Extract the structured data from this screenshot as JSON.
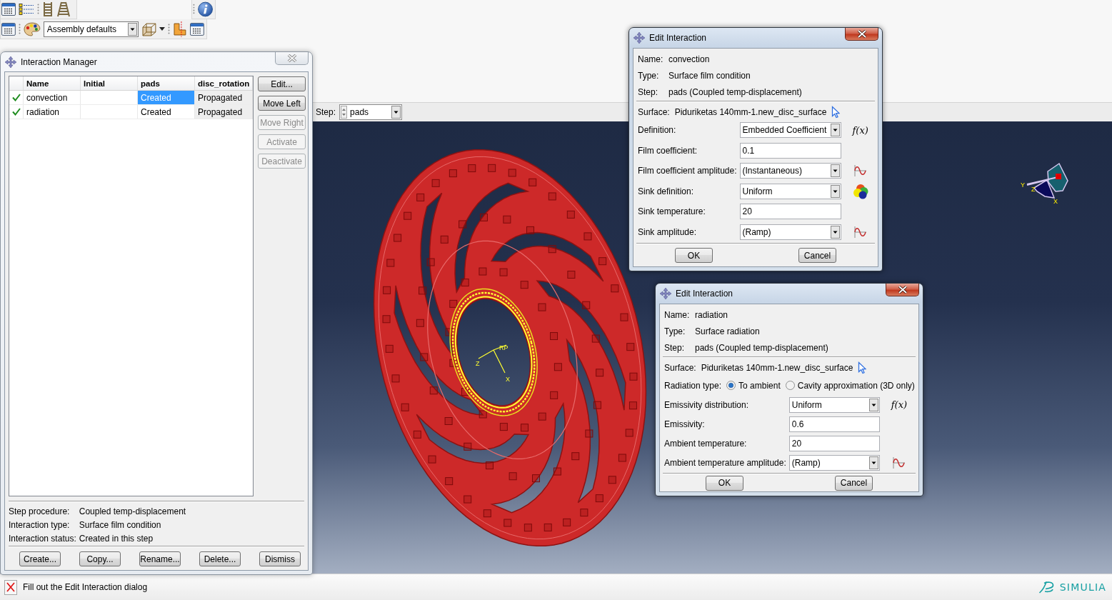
{
  "toolbar": {
    "color_scheme_select": {
      "value": "Assembly defaults"
    }
  },
  "context_bar": {
    "step_label": "Step:",
    "step_select": {
      "value": "pads"
    }
  },
  "viewport": {
    "reference_point": {
      "label": "RP",
      "axis_labels": [
        "Z",
        "X"
      ]
    },
    "view_triad": {
      "axis_labels": [
        "Y",
        "Z",
        "X"
      ]
    }
  },
  "interaction_manager": {
    "title": "Interaction Manager",
    "focused": false,
    "table": {
      "columns": [
        "Name",
        "Initial",
        "pads",
        "disc_rotation"
      ],
      "rows": [
        {
          "active": true,
          "cells": [
            {
              "text": "convection",
              "selected": false,
              "shaded": false
            },
            {
              "selected": false,
              "shaded": false
            },
            {
              "text": "Created",
              "selected": true,
              "shaded": false
            },
            {
              "text": "Propagated",
              "selected": false,
              "shaded": true
            }
          ]
        },
        {
          "active": true,
          "cells": [
            {
              "text": "radiation",
              "selected": false,
              "shaded": false
            },
            {
              "selected": false,
              "shaded": false
            },
            {
              "text": "Created",
              "selected": false,
              "shaded": false
            },
            {
              "text": "Propagated",
              "selected": false,
              "shaded": true
            }
          ]
        }
      ]
    },
    "side_buttons": [
      {
        "label": "Edit...",
        "disabled": false
      },
      {
        "label": "Move Left",
        "disabled": false
      },
      {
        "label": "Move Right",
        "disabled": true
      },
      {
        "label": "Activate",
        "disabled": true
      },
      {
        "label": "Deactivate",
        "disabled": true
      }
    ],
    "details": [
      {
        "label": "Step procedure:",
        "value": "Coupled temp-displacement"
      },
      {
        "label": "Interaction type:",
        "value": "Surface film condition"
      },
      {
        "label": "Interaction status:",
        "value": "Created in this step"
      }
    ],
    "buttons": [
      "Create...",
      "Copy...",
      "Rename...",
      "Delete...",
      "Dismiss"
    ]
  },
  "edit_dialogs": [
    {
      "title": "Edit Interaction",
      "focused": true,
      "info": [
        {
          "label": "Name:",
          "value": "convection"
        },
        {
          "label": "Type:",
          "value": "Surface film condition"
        },
        {
          "label": "Step:",
          "value": "pads (Coupled temp-displacement)"
        }
      ],
      "surface": {
        "label": "Surface:",
        "value": "Piduriketas 140mm-1.new_disc_surface"
      },
      "fields": [
        {
          "kind": "select",
          "label": "Definition:",
          "value": "Embedded Coefficient",
          "accessory": {
            "kind": "function",
            "text": "f(x)"
          }
        },
        {
          "kind": "text",
          "label": "Film coefficient:",
          "value": "0.1"
        },
        {
          "kind": "select",
          "label": "Film coefficient amplitude:",
          "value": "(Instantaneous)",
          "accessory": {
            "kind": "amplitude"
          }
        },
        {
          "kind": "select",
          "label": "Sink definition:",
          "value": "Uniform",
          "accessory": {
            "kind": "distribution"
          }
        },
        {
          "kind": "text",
          "label": "Sink temperature:",
          "value": "20"
        },
        {
          "kind": "select",
          "label": "Sink amplitude:",
          "value": "(Ramp)",
          "accessory": {
            "kind": "amplitude"
          }
        }
      ],
      "buttons": [
        "OK",
        "Cancel"
      ]
    },
    {
      "title": "Edit Interaction",
      "focused": true,
      "info": [
        {
          "label": "Name:",
          "value": "radiation"
        },
        {
          "label": "Type:",
          "value": "Surface radiation"
        },
        {
          "label": "Step:",
          "value": "pads (Coupled temp-displacement)"
        }
      ],
      "surface": {
        "label": "Surface:",
        "value": "Piduriketas 140mm-1.new_disc_surface"
      },
      "fields": [
        {
          "kind": "radio",
          "label": "Radiation type:",
          "options": [
            {
              "label": "To ambient",
              "selected": true
            },
            {
              "label": "Cavity approximation (3D only)",
              "selected": false
            }
          ]
        },
        {
          "kind": "select",
          "label": "Emissivity distribution:",
          "value": "Uniform",
          "accessory": {
            "kind": "function",
            "text": "f(x)"
          }
        },
        {
          "kind": "text",
          "label": "Emissivity:",
          "value": "0.6"
        },
        {
          "kind": "text",
          "label": "Ambient temperature:",
          "value": "20"
        },
        {
          "kind": "select",
          "label": "Ambient temperature amplitude:",
          "value": "(Ramp)",
          "accessory": {
            "kind": "amplitude"
          }
        }
      ],
      "buttons": [
        "OK",
        "Cancel"
      ]
    }
  ],
  "status_bar": {
    "message": "Fill out the Edit Interaction dialog",
    "brand": "SIMULIA"
  }
}
